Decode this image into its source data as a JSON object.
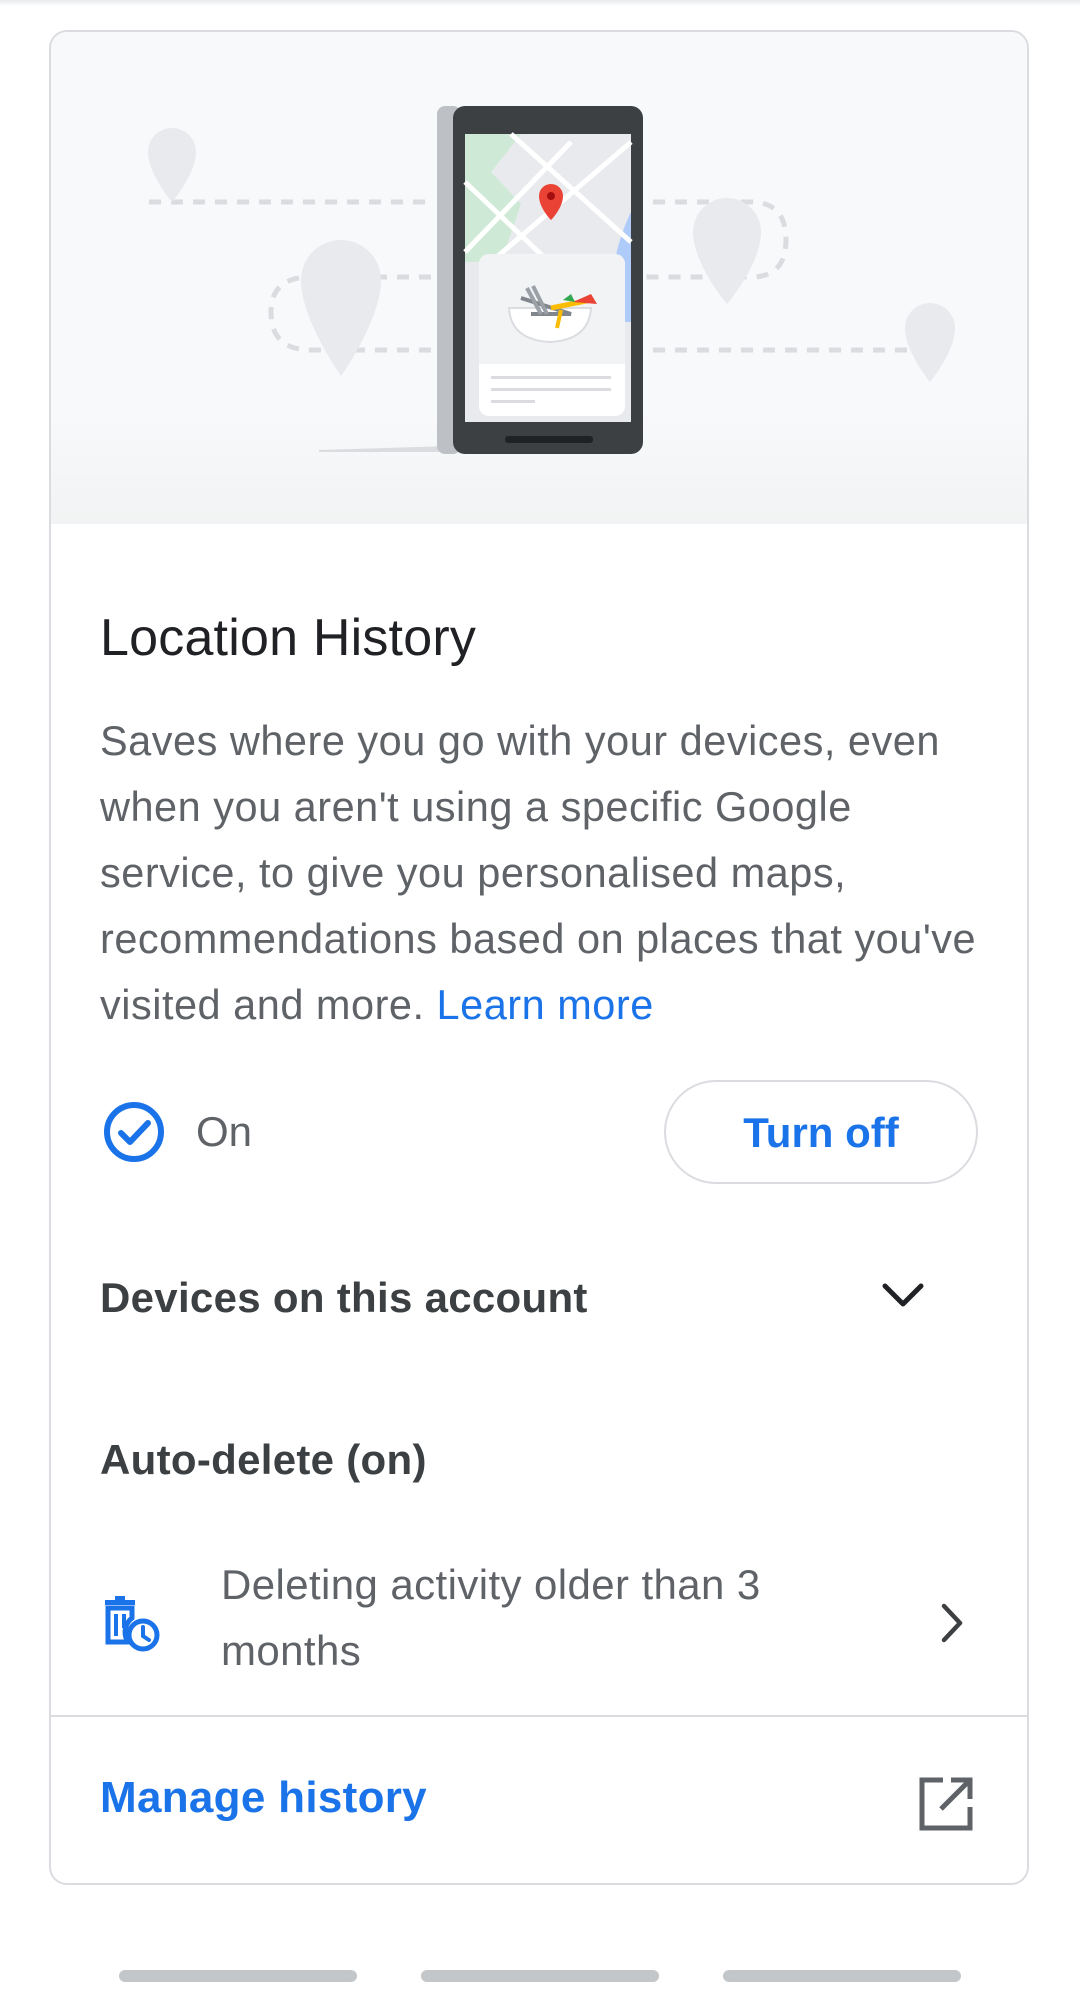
{
  "card": {
    "title": "Location History",
    "description": "Saves where you go with your devices, even when you aren't using a specific Google service, to give you personalised maps, recommendations based on places that you've visited and more.",
    "learn_more": "Learn more",
    "status": {
      "label": "On",
      "icon": "check-circle-icon"
    },
    "turn_off_label": "Turn off",
    "devices_label": "Devices on this account",
    "auto_delete": {
      "heading": "Auto-delete (on)",
      "detail": "Deleting activity older than 3 months",
      "icon": "auto-delete-icon"
    },
    "manage_history_label": "Manage history",
    "manage_icon": "open-in-new-icon"
  },
  "colors": {
    "accent": "#1a73e8",
    "text_primary": "#202124",
    "text_secondary": "#5f6368",
    "border": "#dadce0",
    "pin_red": "#ea4335"
  }
}
